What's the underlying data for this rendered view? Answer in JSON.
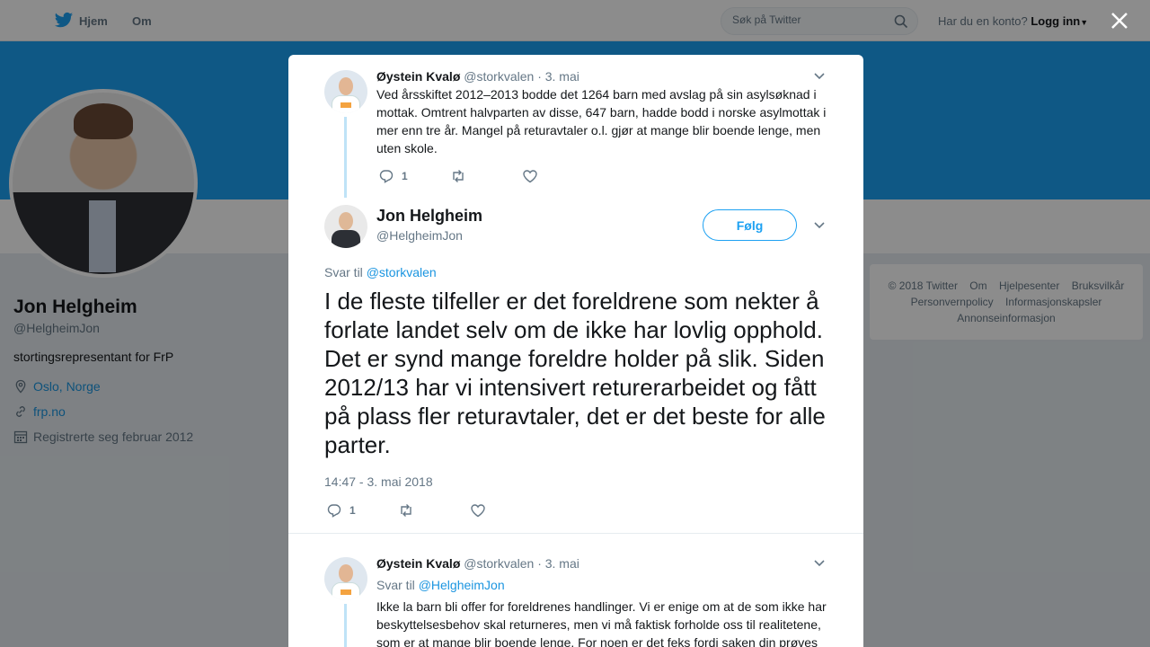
{
  "nav": {
    "home": "Hjem",
    "about": "Om",
    "search_placeholder": "Søk på Twitter",
    "account_question": "Har du en konto?",
    "login": "Logg inn"
  },
  "profile": {
    "name": "Jon Helgheim",
    "handle": "@HelgheimJon",
    "bio": "stortingsrepresentant for FrP",
    "location": "Oslo, Norge",
    "url": "frp.no",
    "joined": "Registrerte seg februar 2012"
  },
  "footer": {
    "copyright": "© 2018 Twitter",
    "about": "Om",
    "help": "Hjelpesenter",
    "terms": "Bruksvilkår",
    "privacy": "Personvernpolicy",
    "cookies": "Informasjonskapsler",
    "ads": "Annonseinformasjon"
  },
  "parent_tweet": {
    "name": "Øystein Kvalø",
    "handle": "@storkvalen",
    "date": "· 3. mai",
    "text": "Ved årsskiftet 2012–2013 bodde det 1264 barn med avslag på sin asylsøknad i mottak. Omtrent halvparten av disse, 647 barn, hadde bodd i norske asylmottak i mer enn tre år. Mangel på returavtaler o.l. gjør at mange blir boende lenge, men uten skole.",
    "replies": "1"
  },
  "main_tweet": {
    "name": "Jon Helgheim",
    "handle": "@HelgheimJon",
    "follow": "Følg",
    "replying_prefix": "Svar til",
    "replying_to": "@storkvalen",
    "text": "I de fleste tilfeller er det foreldrene som nekter å forlate landet selv om de ikke har lovlig opphold. Det er synd mange foreldre holder på slik. Siden 2012/13 har vi intensivert returerarbeidet og fått på plass fler returavtaler, det er det beste for alle parter.",
    "timestamp": "14:47 - 3. mai 2018",
    "replies": "1"
  },
  "reply_tweet": {
    "name": "Øystein Kvalø",
    "handle": "@storkvalen",
    "date": "· 3. mai",
    "replying_prefix": "Svar til",
    "replying_to": "@HelgheimJon",
    "text": "Ikke la barn bli offer for foreldrenes handlinger. Vi er enige om at de som ikke har beskyttelsesbehov skal returneres, men vi må faktisk forholde oss til realitetene, som er at mange blir boende lenge. For noen er det feks fordi saken din prøves"
  },
  "colors": {
    "accent": "#1da1f2",
    "link": "#1b95e0",
    "muted": "#657786"
  }
}
